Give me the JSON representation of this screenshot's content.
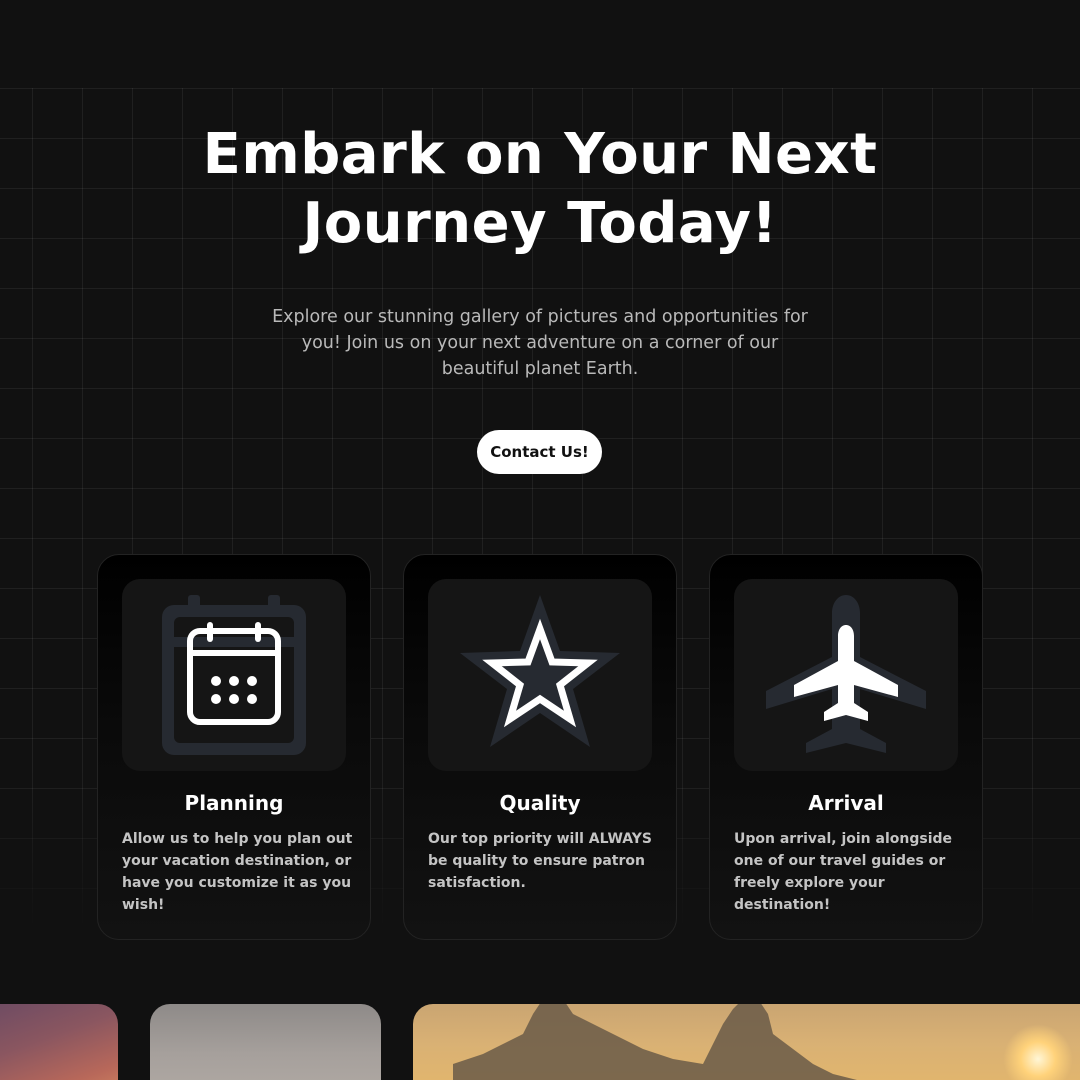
{
  "hero": {
    "title_line1": "Embark on Your Next",
    "title_line2": "Journey Today!",
    "subtitle": "Explore our stunning gallery of pictures and opportunities for you! Join us on your next adventure on a corner of our beautiful planet Earth.",
    "cta_label": "Contact Us!"
  },
  "features": [
    {
      "icon": "calendar-icon",
      "title": "Planning",
      "description": "Allow us to help you plan out your vacation destination, or have you customize it as you wish!"
    },
    {
      "icon": "star-icon",
      "title": "Quality",
      "description": "Our top priority will ALWAYS be quality to ensure patron satisfaction."
    },
    {
      "icon": "airplane-icon",
      "title": "Arrival",
      "description": "Upon arrival, join alongside one of our travel guides or freely explore your destination!"
    }
  ],
  "colors": {
    "background": "#111111",
    "card": "#000000",
    "icon_shadow": "#262a31",
    "text_muted": "#b9b9b9",
    "button": "#ffffff"
  }
}
